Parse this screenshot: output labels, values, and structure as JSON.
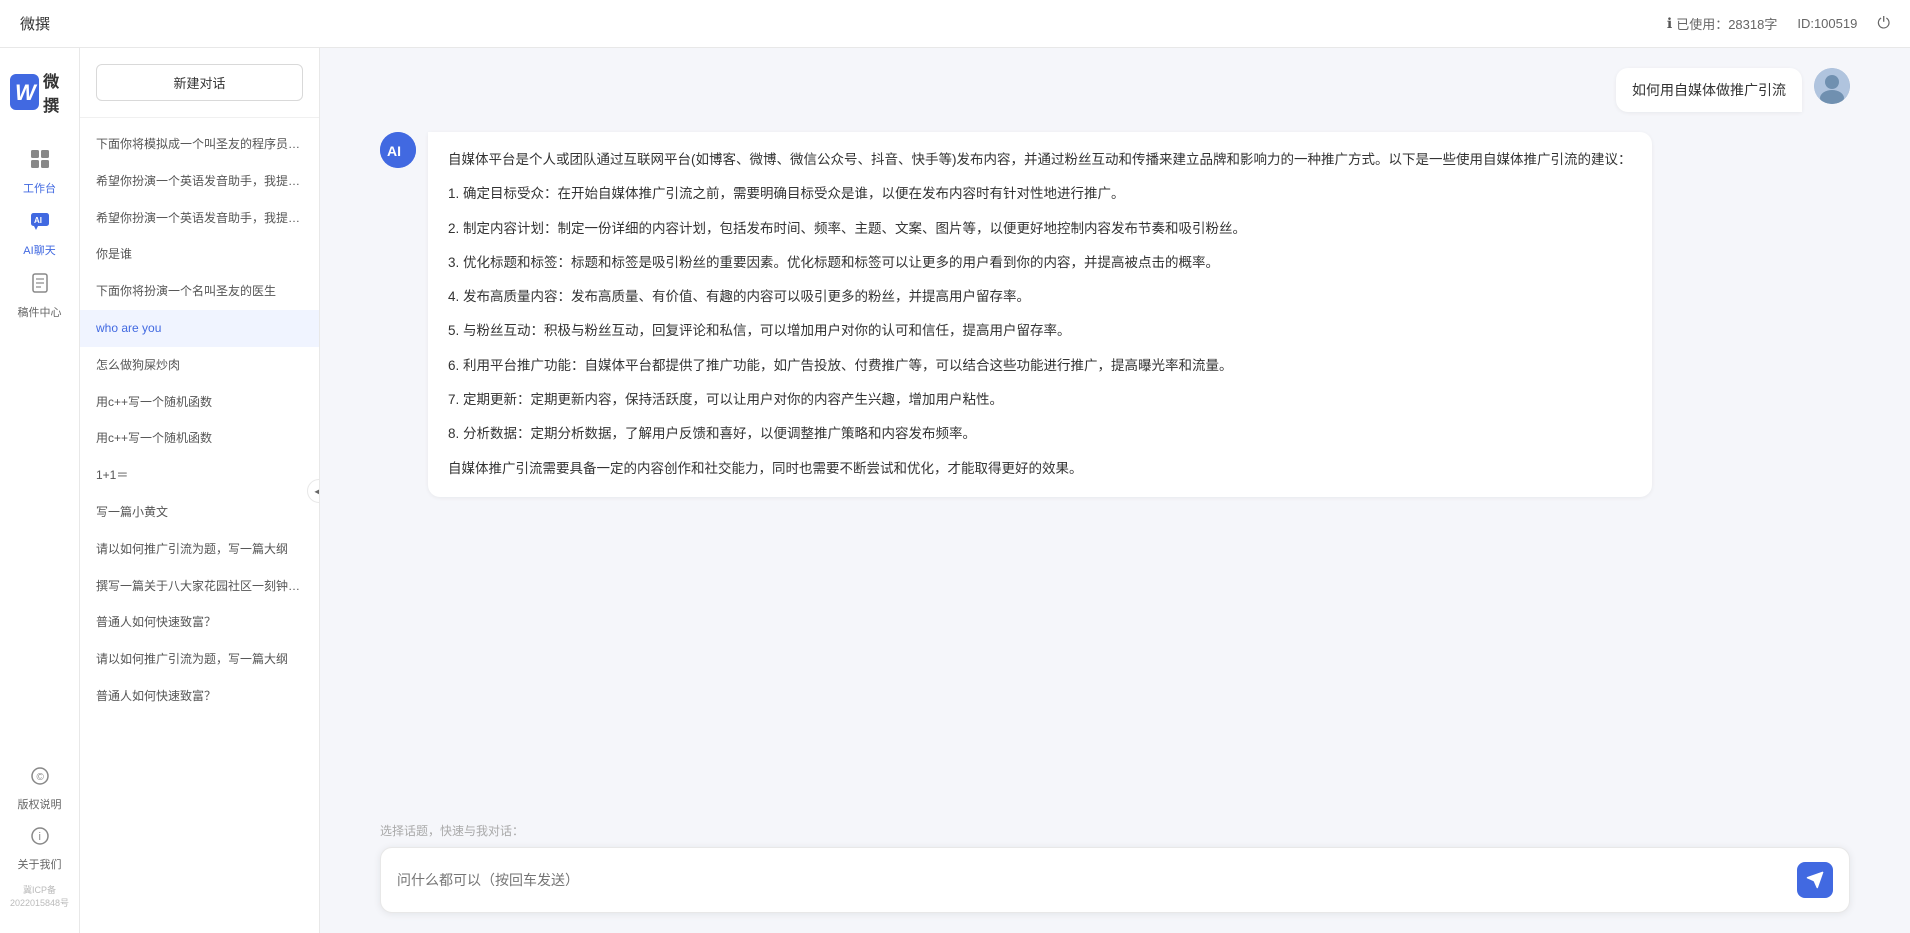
{
  "topbar": {
    "title": "微撰",
    "usage_label": "已使用：28318字",
    "id_label": "ID:100519",
    "usage_icon": "ℹ"
  },
  "logo": {
    "w": "W",
    "text": "微撰"
  },
  "nav": {
    "items": [
      {
        "id": "workbench",
        "icon": "🖥",
        "label": "工作台"
      },
      {
        "id": "ai-chat",
        "icon": "💬",
        "label": "AI聊天",
        "active": true
      },
      {
        "id": "drafts",
        "icon": "📁",
        "label": "稿件中心"
      }
    ],
    "bottom": [
      {
        "id": "copyright",
        "icon": "©",
        "label": "版权说明"
      },
      {
        "id": "about",
        "icon": "ℹ",
        "label": "关于我们"
      }
    ],
    "icp": "冀ICP备2022015848号"
  },
  "sidebar": {
    "new_chat_label": "新建对话",
    "items": [
      {
        "id": 1,
        "text": "下面你将模拟成一个叫圣友的程序员，我说...",
        "active": false
      },
      {
        "id": 2,
        "text": "希望你扮演一个英语发音助手，我提供给你...",
        "active": false
      },
      {
        "id": 3,
        "text": "希望你扮演一个英语发音助手，我提供给你...",
        "active": false
      },
      {
        "id": 4,
        "text": "你是谁",
        "active": false
      },
      {
        "id": 5,
        "text": "下面你将扮演一个名叫圣友的医生",
        "active": false
      },
      {
        "id": 6,
        "text": "who are you",
        "active": true
      },
      {
        "id": 7,
        "text": "怎么做狗屎炒肉",
        "active": false
      },
      {
        "id": 8,
        "text": "用c++写一个随机函数",
        "active": false
      },
      {
        "id": 9,
        "text": "用c++写一个随机函数",
        "active": false
      },
      {
        "id": 10,
        "text": "1+1＝",
        "active": false
      },
      {
        "id": 11,
        "text": "写一篇小黄文",
        "active": false
      },
      {
        "id": 12,
        "text": "请以如何推广引流为题，写一篇大纲",
        "active": false
      },
      {
        "id": 13,
        "text": "撰写一篇关于八大家花园社区一刻钟便民生...",
        "active": false
      },
      {
        "id": 14,
        "text": "普通人如何快速致富？",
        "active": false
      },
      {
        "id": 15,
        "text": "请以如何推广引流为题，写一篇大纲",
        "active": false
      },
      {
        "id": 16,
        "text": "普通人如何快速致富？",
        "active": false
      }
    ]
  },
  "chat": {
    "user_message": "如何用自媒体做推广引流",
    "ai_response": {
      "paragraphs": [
        "自媒体平台是个人或团队通过互联网平台(如博客、微博、微信公众号、抖音、快手等)发布内容，并通过粉丝互动和传播来建立品牌和影响力的一种推广方式。以下是一些使用自媒体推广引流的建议：",
        "1. 确定目标受众：在开始自媒体推广引流之前，需要明确目标受众是谁，以便在发布内容时有针对性地进行推广。",
        "2. 制定内容计划：制定一份详细的内容计划，包括发布时间、频率、主题、文案、图片等，以便更好地控制内容发布节奏和吸引粉丝。",
        "3. 优化标题和标签：标题和标签是吸引粉丝的重要因素。优化标题和标签可以让更多的用户看到你的内容，并提高被点击的概率。",
        "4. 发布高质量内容：发布高质量、有价值、有趣的内容可以吸引更多的粉丝，并提高用户留存率。",
        "5. 与粉丝互动：积极与粉丝互动，回复评论和私信，可以增加用户对你的认可和信任，提高用户留存率。",
        "6. 利用平台推广功能：自媒体平台都提供了推广功能，如广告投放、付费推广等，可以结合这些功能进行推广，提高曝光率和流量。",
        "7. 定期更新：定期更新内容，保持活跃度，可以让用户对你的内容产生兴趣，增加用户粘性。",
        "8. 分析数据：定期分析数据，了解用户反馈和喜好，以便调整推广策略和内容发布频率。",
        "自媒体推广引流需要具备一定的内容创作和社交能力，同时也需要不断尝试和优化，才能取得更好的效果。"
      ]
    },
    "quick_topic_placeholder": "选择话题，快速与我对话：",
    "input_placeholder": "问什么都可以（按回车发送）"
  }
}
